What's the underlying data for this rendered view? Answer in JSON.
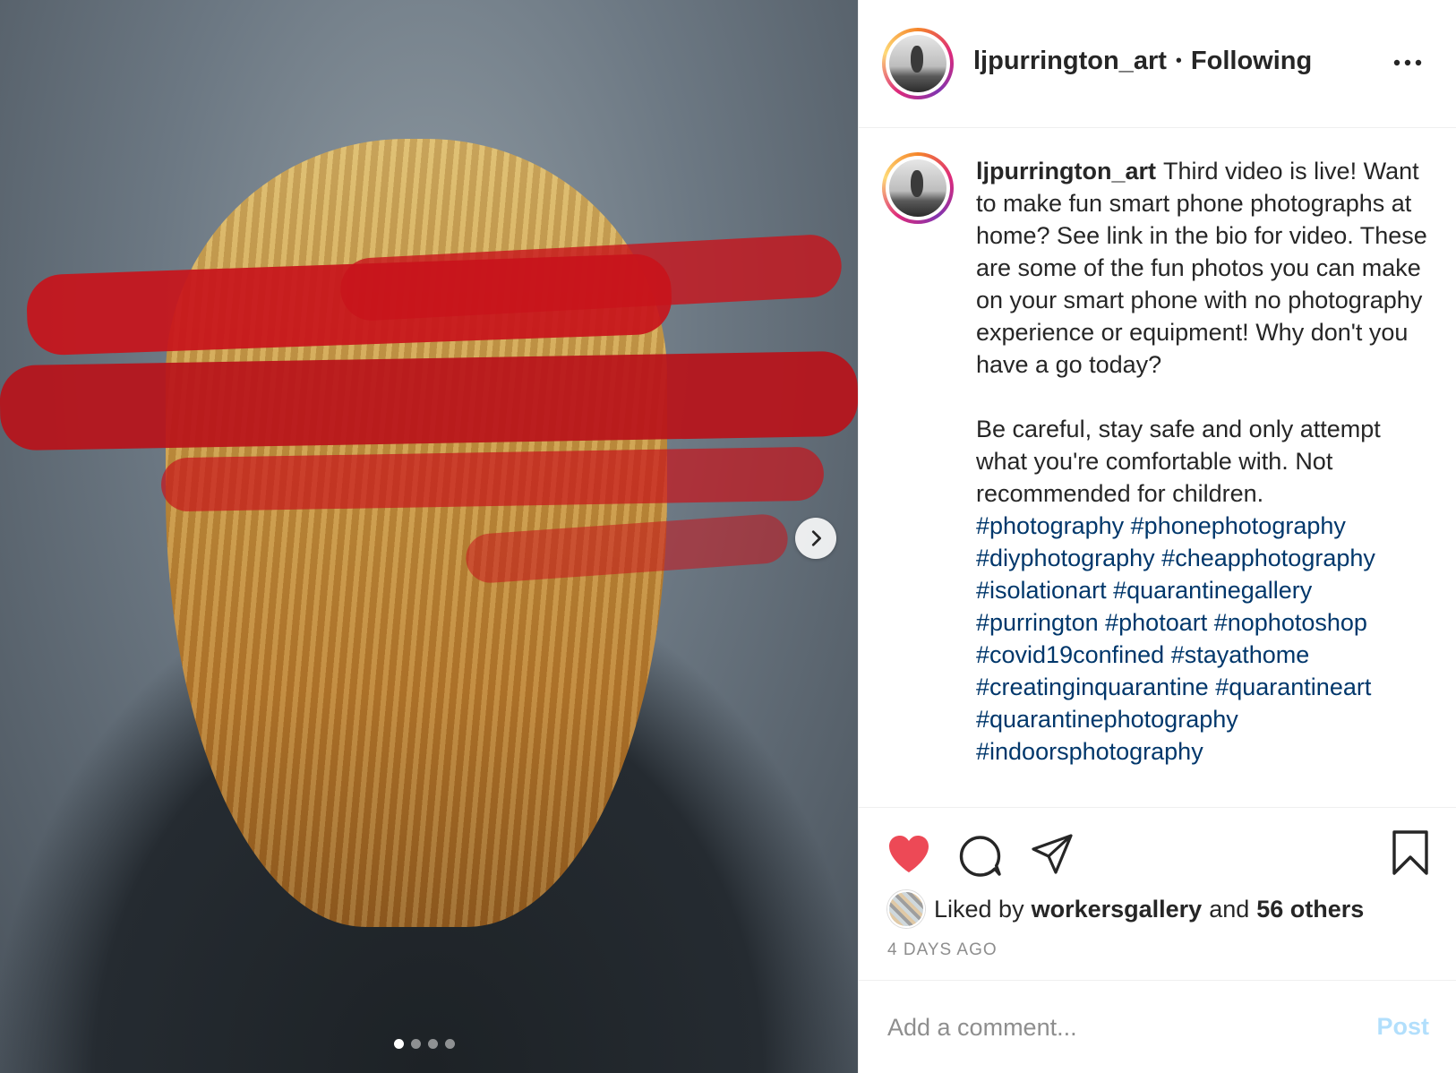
{
  "post": {
    "username": "ljpurrington_art",
    "bullet": "•",
    "follow_status": "Following",
    "caption": "Third video is live! Want to make fun smart phone photographs at home? See link in the bio for video. These are some of the fun photos you can make on your smart phone with no photography experience or equipment! Why don't you have a go today?",
    "caption2": "Be careful, stay safe and only attempt what you're comfortable with. Not recommended for children.",
    "hashtags": [
      "#photography",
      "#phonephotography",
      "#diyphotography",
      "#cheapphotography",
      "#isolationart",
      "#quarantinegallery",
      "#purrington",
      "#photoart",
      "#nophotoshop",
      "#covid19confined",
      "#stayathome",
      "#creatinginquarantine",
      "#quarantineart",
      "#quarantinephotography",
      "#indoorsphotography"
    ],
    "liked_by_prefix": "Liked by",
    "liked_by_user": "workersgallery",
    "liked_and": "and",
    "liked_others": "56 others",
    "time_ago": "4 DAYS AGO",
    "comment_placeholder": "Add a comment...",
    "post_label": "Post",
    "carousel": {
      "count": 4,
      "active_index": 0
    }
  },
  "colors": {
    "like_red": "#ed4956",
    "hashtag_blue": "#00376b",
    "post_disabled": "#b2dffc",
    "paint_red": "#c8141b"
  },
  "icons": [
    "more-icon",
    "heart-icon",
    "comment-icon",
    "share-icon",
    "bookmark-icon",
    "chevron-right-icon"
  ]
}
